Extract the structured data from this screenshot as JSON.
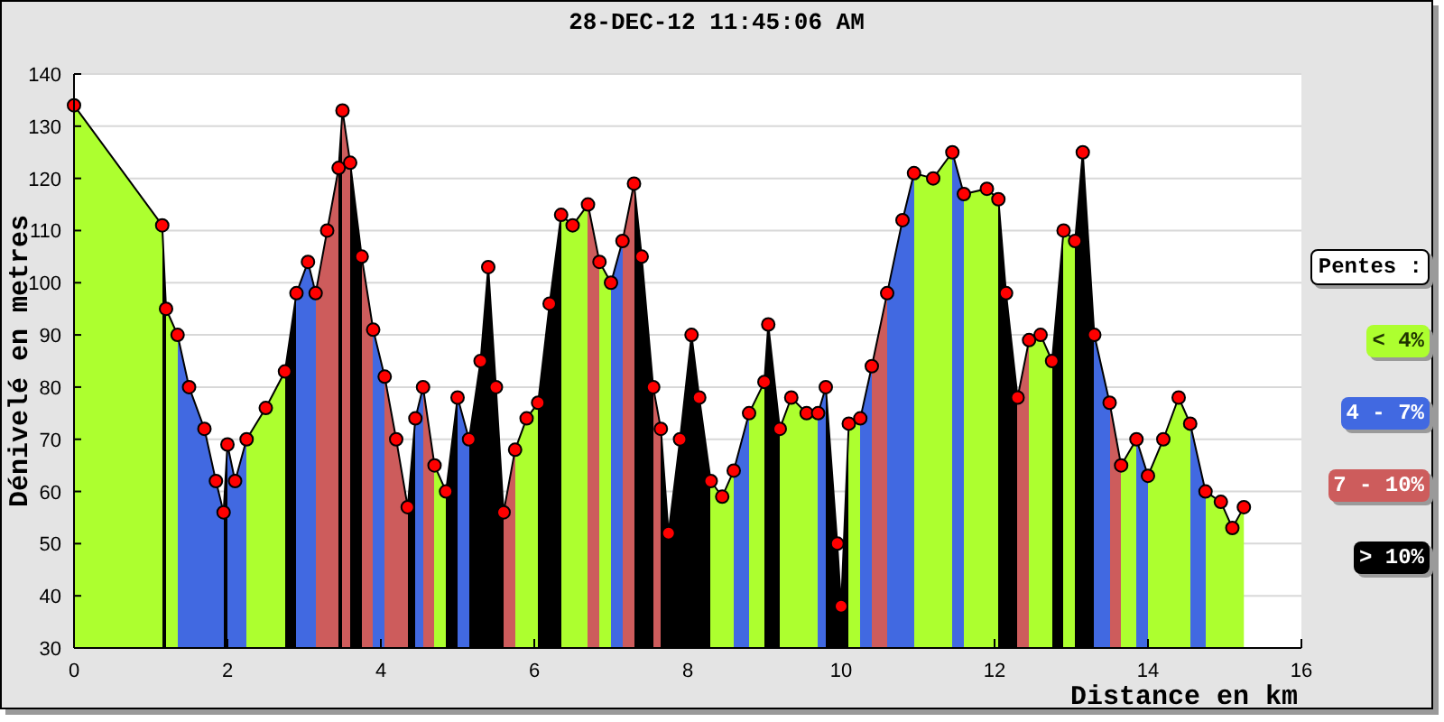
{
  "chart_data": {
    "type": "area",
    "title": "28-DEC-12 11:45:06 AM",
    "xlabel": "Distance en km",
    "ylabel": "Dénivelé en metres",
    "x": [
      0,
      1.15,
      1.2,
      1.35,
      1.5,
      1.7,
      1.85,
      1.95,
      2.0,
      2.1,
      2.25,
      2.5,
      2.75,
      2.9,
      3.05,
      3.15,
      3.3,
      3.45,
      3.5,
      3.6,
      3.75,
      3.9,
      4.05,
      4.2,
      4.35,
      4.45,
      4.55,
      4.7,
      4.85,
      5.0,
      5.15,
      5.3,
      5.4,
      5.5,
      5.6,
      5.75,
      5.9,
      6.05,
      6.2,
      6.35,
      6.5,
      6.7,
      6.85,
      7.0,
      7.15,
      7.3,
      7.4,
      7.55,
      7.65,
      7.75,
      7.9,
      8.05,
      8.15,
      8.3,
      8.45,
      8.6,
      8.8,
      9.0,
      9.05,
      9.2,
      9.35,
      9.55,
      9.7,
      9.8,
      9.95,
      10.0,
      10.1,
      10.25,
      10.4,
      10.6,
      10.8,
      10.95,
      11.2,
      11.45,
      11.6,
      11.9,
      12.05,
      12.15,
      12.3,
      12.45,
      12.6,
      12.75,
      12.9,
      13.05,
      13.15,
      13.3,
      13.5,
      13.65,
      13.85,
      14.0,
      14.2,
      14.4,
      14.55,
      14.75,
      14.95,
      15.1,
      15.25
    ],
    "series": [
      {
        "color": "#ff0000",
        "values": [
          134,
          111,
          95,
          90,
          80,
          72,
          62,
          56,
          69,
          62,
          70,
          76,
          83,
          98,
          104,
          98,
          110,
          122,
          133,
          123,
          105,
          91,
          82,
          70,
          57,
          74,
          80,
          65,
          60,
          78,
          70,
          85,
          103,
          80,
          56,
          68,
          74,
          77,
          96,
          113,
          111,
          115,
          104,
          100,
          108,
          119,
          105,
          80,
          72,
          52,
          70,
          90,
          78,
          62,
          59,
          64,
          75,
          81,
          92,
          72,
          78,
          75,
          75,
          80,
          50,
          38,
          73,
          74,
          84,
          98,
          112,
          121,
          120,
          125,
          117,
          118,
          116,
          98,
          78,
          89,
          90,
          85,
          110,
          108,
          125,
          90,
          77,
          65,
          70,
          63,
          70,
          78,
          73,
          60,
          58,
          53,
          57
        ]
      }
    ],
    "grid": true,
    "xlim": [
      0,
      16
    ],
    "ylim": [
      30,
      140
    ],
    "xticks": [
      0,
      2,
      4,
      6,
      8,
      10,
      12,
      14,
      16
    ],
    "yticks": [
      30,
      40,
      50,
      60,
      70,
      80,
      90,
      100,
      110,
      120,
      130,
      140
    ]
  },
  "legend": {
    "title": "Pentes :",
    "items": [
      {
        "label": "< 4%",
        "color": "#adff2f"
      },
      {
        "label": "4 - 7%",
        "color": "#4169e1"
      },
      {
        "label": "7 - 10%",
        "color": "#cd5c5c"
      },
      {
        "label": "> 10%",
        "color": "#000000"
      }
    ]
  }
}
